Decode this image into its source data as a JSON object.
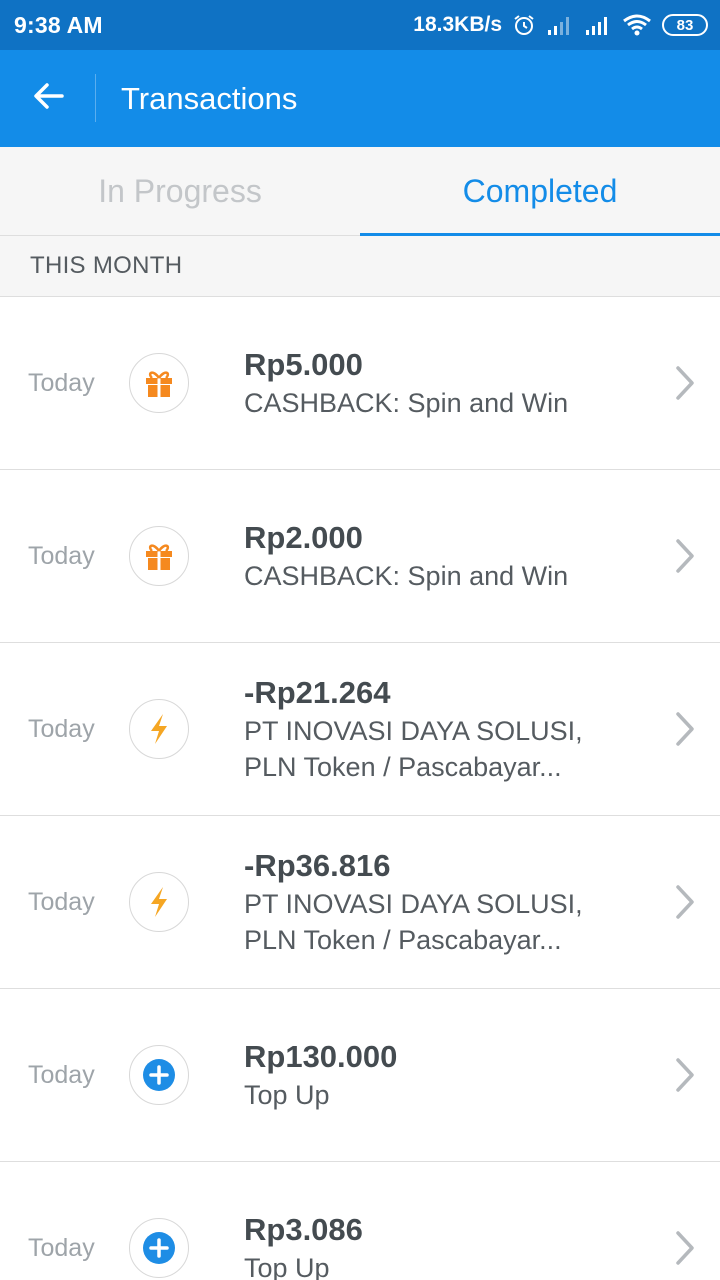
{
  "status_bar": {
    "time": "9:38 AM",
    "net_speed": "18.3KB/s",
    "battery": "83",
    "icons": [
      "alarm-icon",
      "signal-weak-icon",
      "signal-icon",
      "wifi-icon",
      "battery-icon"
    ]
  },
  "app_bar": {
    "title": "Transactions",
    "back_icon": "arrow-left-icon"
  },
  "tabs": [
    {
      "label": "In Progress",
      "active": false
    },
    {
      "label": "Completed",
      "active": true
    }
  ],
  "section": {
    "title": "THIS MONTH"
  },
  "transactions": [
    {
      "date": "Today",
      "icon": "gift-icon",
      "amount": "Rp5.000",
      "desc_line1": "CASHBACK: Spin and Win",
      "desc_line2": ""
    },
    {
      "date": "Today",
      "icon": "gift-icon",
      "amount": "Rp2.000",
      "desc_line1": "CASHBACK: Spin and Win",
      "desc_line2": ""
    },
    {
      "date": "Today",
      "icon": "lightning-icon",
      "amount": "-Rp21.264",
      "desc_line1": "PT INOVASI DAYA SOLUSI,",
      "desc_line2": "PLN Token / Pascabayar..."
    },
    {
      "date": "Today",
      "icon": "lightning-icon",
      "amount": "-Rp36.816",
      "desc_line1": "PT INOVASI DAYA SOLUSI,",
      "desc_line2": "PLN Token / Pascabayar..."
    },
    {
      "date": "Today",
      "icon": "plus-circle-icon",
      "amount": "Rp130.000",
      "desc_line1": "Top Up",
      "desc_line2": ""
    },
    {
      "date": "Today",
      "icon": "plus-circle-icon",
      "amount": "Rp3.086",
      "desc_line1": "Top Up",
      "desc_line2": ""
    }
  ],
  "colors": {
    "status_bar": "#0f72c4",
    "app_bar": "#138ce8",
    "accent": "#138ce8",
    "gift": "#f5891f",
    "lightning": "#f5a623",
    "plus": "#1e8de5"
  }
}
